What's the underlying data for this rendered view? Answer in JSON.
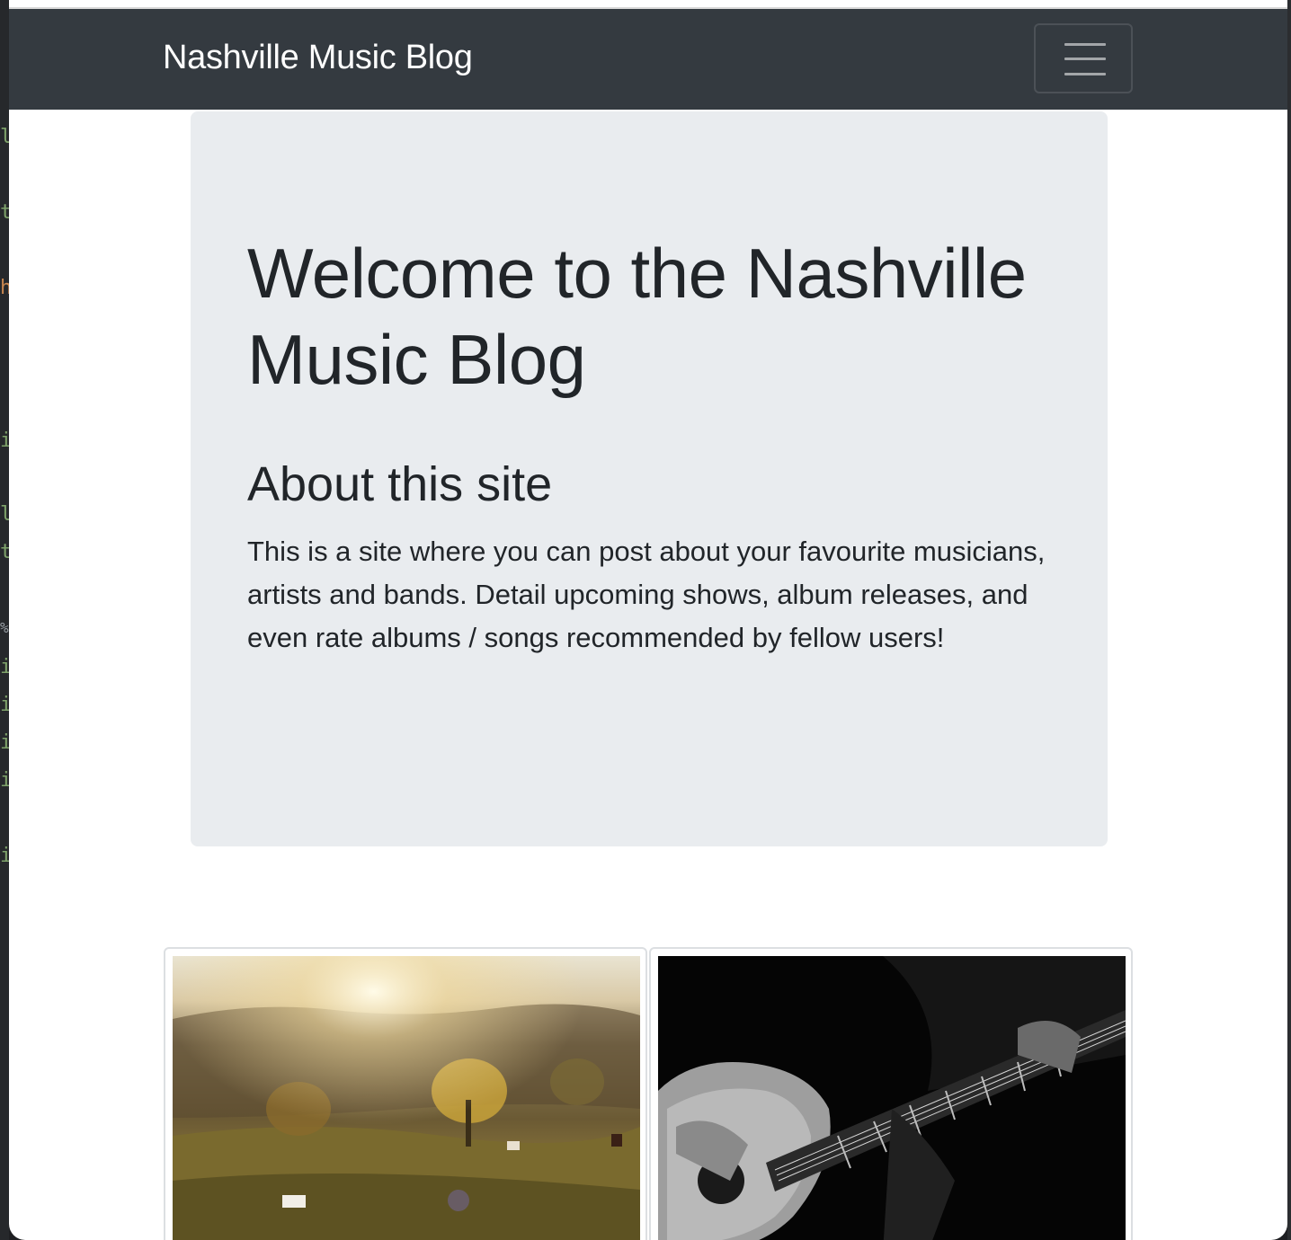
{
  "navbar": {
    "brand": "Nashville Music Blog",
    "toggler_icon": "hamburger-menu-icon"
  },
  "jumbotron": {
    "title": "Welcome to the Nashville Music Blog",
    "about_heading": "About this site",
    "about_text": "This is a site where you can post about your favourite musicians, artists and bands. Detail upcoming shows, album releases, and even rate albums / songs recommended by fellow users!"
  },
  "cards": [
    {
      "image": "sunset-pasture-horses-photo"
    },
    {
      "image": "guitarist-playing-acoustic-guitar-photo"
    }
  ],
  "colors": {
    "navbar_bg": "#343a40",
    "jumbotron_bg": "#e9ecef",
    "text": "#212529"
  }
}
